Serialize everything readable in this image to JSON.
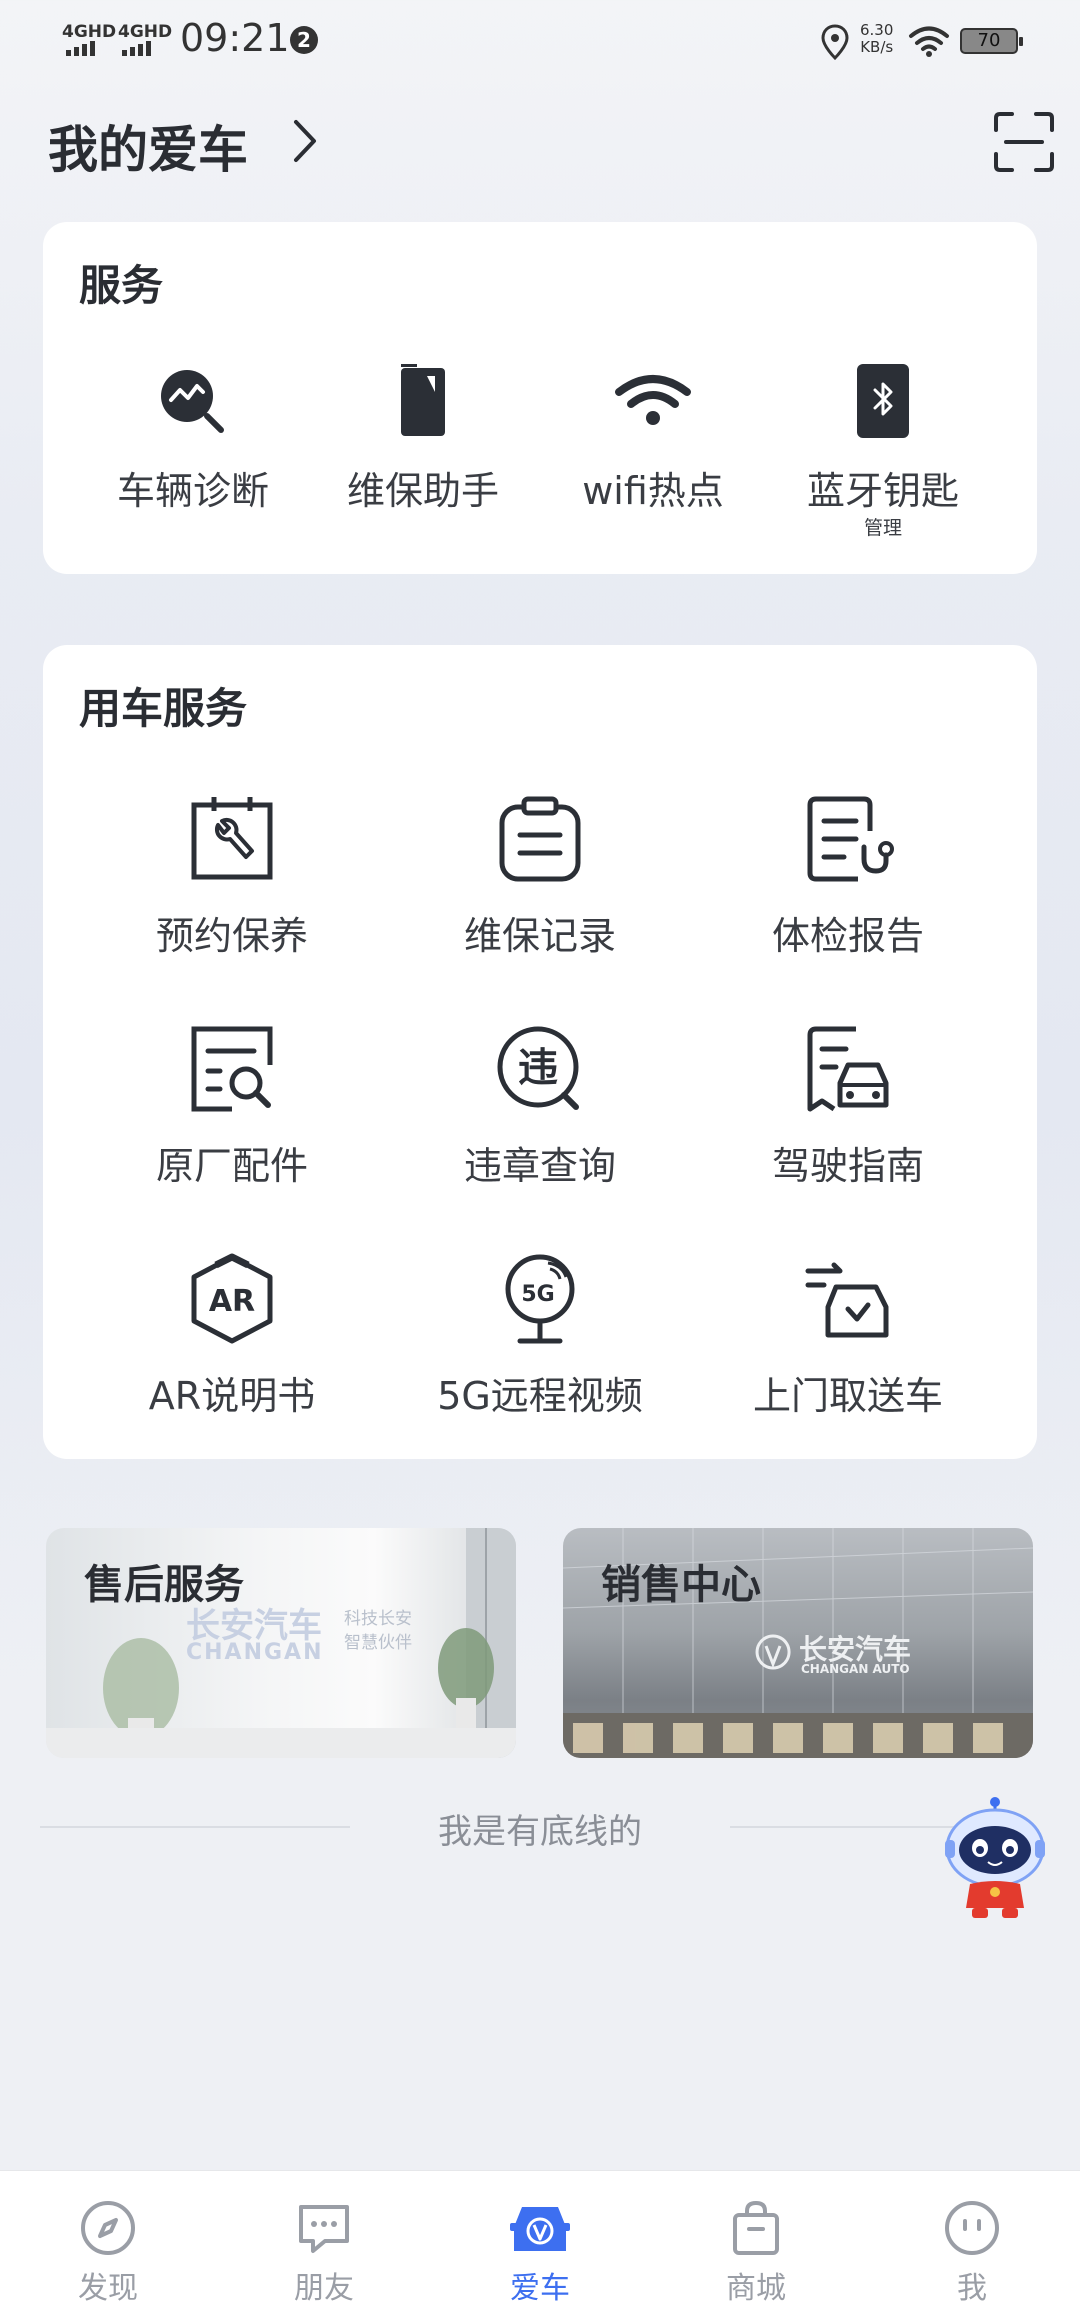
{
  "status_bar": {
    "signal_1": "4GHD",
    "signal_2": "4GHD",
    "time": "09:21",
    "notification_count": "2",
    "net_speed_value": "6.30",
    "net_speed_unit": "KB/s",
    "battery": "70"
  },
  "header": {
    "title": "我的爱车"
  },
  "service_card": {
    "title": "服务",
    "items": [
      {
        "label": "车辆诊断",
        "icon": "diagnosis-icon"
      },
      {
        "label": "维保助手",
        "icon": "maintenance-assistant-icon"
      },
      {
        "label": "wifi热点",
        "icon": "wifi-icon"
      },
      {
        "label": "蓝牙钥匙",
        "sub": "管理",
        "icon": "bluetooth-key-icon"
      }
    ]
  },
  "car_service_card": {
    "title": "用车服务",
    "items": [
      {
        "label": "预约保养",
        "icon": "calendar-wrench-icon"
      },
      {
        "label": "维保记录",
        "icon": "clipboard-icon"
      },
      {
        "label": "体检报告",
        "icon": "report-stethoscope-icon"
      },
      {
        "label": "原厂配件",
        "icon": "document-search-icon"
      },
      {
        "label": "违章查询",
        "icon": "violation-search-icon"
      },
      {
        "label": "驾驶指南",
        "icon": "driving-guide-icon"
      },
      {
        "label": "AR说明书",
        "icon": "ar-cube-icon"
      },
      {
        "label": "5G远程视频",
        "icon": "5g-camera-icon"
      },
      {
        "label": "上门取送车",
        "icon": "car-pickup-icon"
      }
    ]
  },
  "banners": {
    "after_sales": {
      "title": "售后服务",
      "brand_cn": "长安汽车",
      "brand_en": "CHANGAN",
      "slogan_1": "科技长安",
      "slogan_2": "智慧伙伴"
    },
    "sales": {
      "title": "销售中心",
      "brand_cn": "长安汽车",
      "brand_en": "CHANGAN AUTO"
    }
  },
  "footer_note": "我是有底线的",
  "tabbar": {
    "tabs": [
      {
        "label": "发现",
        "icon": "compass-icon"
      },
      {
        "label": "朋友",
        "icon": "chat-icon"
      },
      {
        "label": "爱车",
        "icon": "car-icon",
        "active": true
      },
      {
        "label": "商城",
        "icon": "shopping-bag-icon"
      },
      {
        "label": "我",
        "icon": "profile-face-icon"
      }
    ]
  },
  "colors": {
    "accent": "#3d6ff0",
    "icon_dark": "#2b2f36",
    "text_muted": "#9a9ea6"
  }
}
